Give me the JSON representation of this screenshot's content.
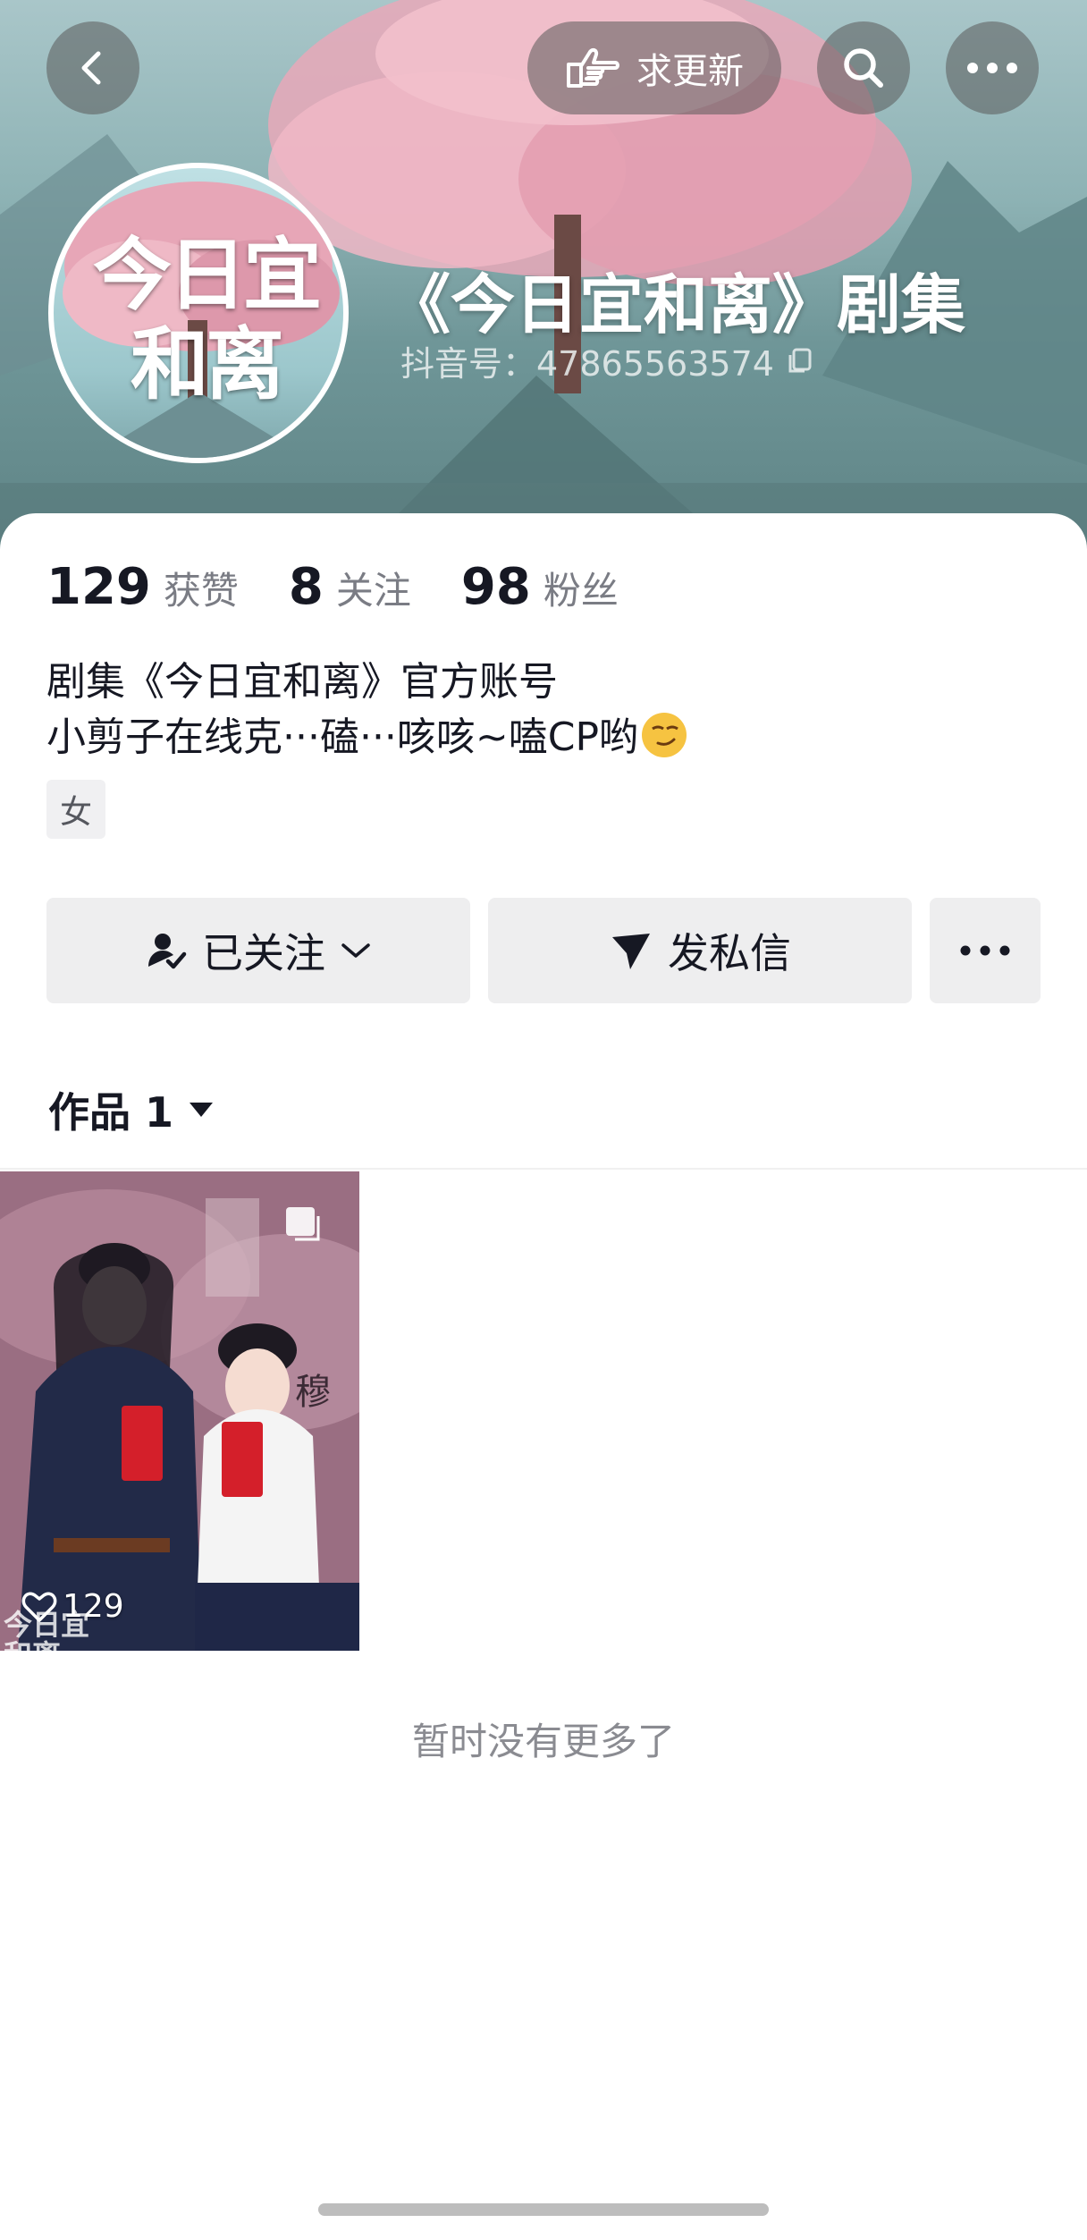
{
  "header": {
    "request_update_label": "求更新",
    "avatar_text": "今日宜和离",
    "name": "《今日宜和离》剧集",
    "douyin_id": "抖音号：47865563574"
  },
  "stats": {
    "likes": {
      "value": "129",
      "label": "获赞"
    },
    "following": {
      "value": "8",
      "label": "关注"
    },
    "fans": {
      "value": "98",
      "label": "粉丝"
    }
  },
  "bio": {
    "line1": "剧集《今日宜和离》官方账号",
    "line2": "小剪子在线克···磕···咳咳~嗑CP哟"
  },
  "gender_tag": "女",
  "actions": {
    "followed_label": "已关注",
    "message_label": "发私信"
  },
  "works_tab": {
    "label": "作品 1"
  },
  "video": {
    "like_count": "129",
    "poster_text": "今日宜和离",
    "poster_text2": "穆"
  },
  "footer": {
    "no_more": "暂时没有更多了"
  },
  "colors": {
    "primary_text": "#161823",
    "secondary_text": "#7a7c84",
    "button_bg": "#eeeeef"
  },
  "icons": [
    "back-icon",
    "hand-point-icon",
    "search-icon",
    "more-icon",
    "copy-icon",
    "user-check-icon",
    "chevron-down-icon",
    "send-icon",
    "caret-down-icon",
    "heart-icon",
    "select-box-icon",
    "smirk-emoji-icon"
  ]
}
